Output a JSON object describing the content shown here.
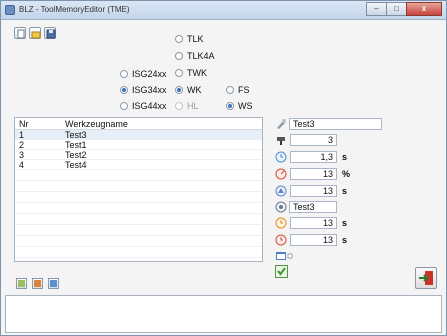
{
  "window": {
    "title": "BLZ - ToolMemoryEditor (TME)",
    "controls": {
      "minimize": "–",
      "maximize": "□",
      "close": "x"
    }
  },
  "toolbar": {
    "buttons": [
      {
        "icon": "new-document-icon"
      },
      {
        "icon": "open-folder-icon"
      },
      {
        "icon": "save-disk-icon"
      }
    ]
  },
  "types": {
    "isg": [
      {
        "label": "ISG24xx",
        "checked": false,
        "enabled": true
      },
      {
        "label": "ISG34xx",
        "checked": true,
        "enabled": true
      },
      {
        "label": "ISG44xx",
        "checked": false,
        "enabled": true
      }
    ],
    "tool": [
      {
        "label": "TLK",
        "checked": false,
        "enabled": true
      },
      {
        "label": "TLK4A",
        "checked": false,
        "enabled": true
      },
      {
        "label": "TWK",
        "checked": false,
        "enabled": true
      },
      {
        "label": "WK",
        "checked": true,
        "enabled": true
      },
      {
        "label": "HL",
        "checked": false,
        "enabled": false
      }
    ],
    "mode": [
      {
        "label": "FS",
        "checked": false,
        "enabled": true
      },
      {
        "label": "WS",
        "checked": true,
        "enabled": true
      }
    ]
  },
  "tool_list": {
    "columns": [
      "Nr",
      "Werkzeugname"
    ],
    "rows": [
      {
        "nr": "1",
        "name": "Test3",
        "selected": true
      },
      {
        "nr": "2",
        "name": "Test1",
        "selected": false
      },
      {
        "nr": "3",
        "name": "Test2",
        "selected": false
      },
      {
        "nr": "4",
        "name": "Test4",
        "selected": false
      }
    ]
  },
  "properties": [
    {
      "icon": "tool-name-icon",
      "value": "Test3",
      "unit": "",
      "wide": true
    },
    {
      "icon": "drill-icon",
      "value": "3",
      "unit": ""
    },
    {
      "icon": "timer-icon",
      "value": "1,3",
      "unit": "s"
    },
    {
      "icon": "gauge-red-icon",
      "value": "13",
      "unit": "%"
    },
    {
      "icon": "pressure-icon",
      "value": "13",
      "unit": "s"
    },
    {
      "icon": "refresh-icon",
      "value": "Test3",
      "unit": "",
      "wide": true
    },
    {
      "icon": "clock-orange-icon",
      "value": "13",
      "unit": "s"
    },
    {
      "icon": "clock-red-icon",
      "value": "13",
      "unit": "s"
    }
  ],
  "colors": {
    "accent": "#3a73c6",
    "selection": "#e6eef8",
    "check_green": "#3c9a2a",
    "exit_red": "#c9342a"
  }
}
